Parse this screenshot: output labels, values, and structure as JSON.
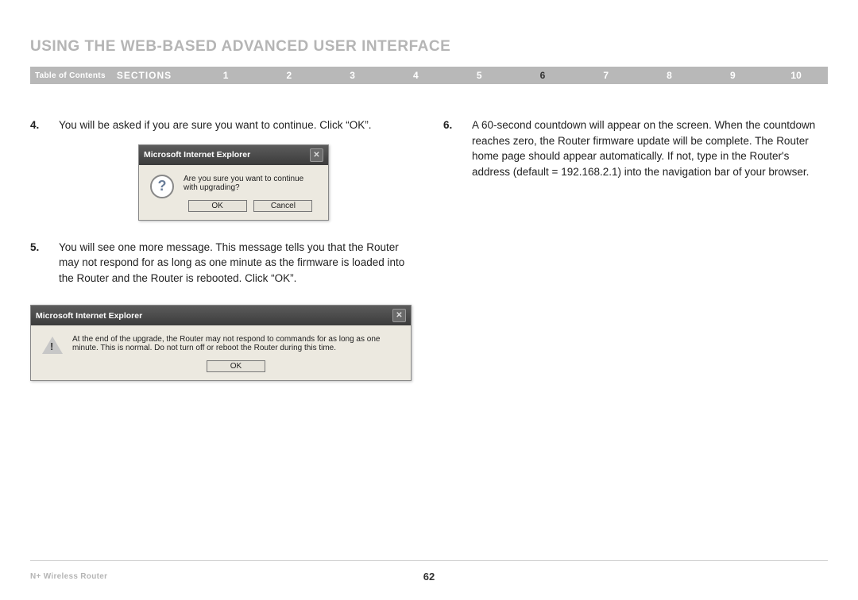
{
  "header": {
    "title": "USING THE WEB-BASED ADVANCED USER INTERFACE"
  },
  "nav": {
    "toc": "Table of Contents",
    "sections_label": "SECTIONS",
    "items": [
      "1",
      "2",
      "3",
      "4",
      "5",
      "6",
      "7",
      "8",
      "9",
      "10"
    ],
    "active_index": 5
  },
  "steps": [
    {
      "num": "4.",
      "text": "You will be asked if you are sure you want to continue. Click “OK”."
    },
    {
      "num": "5.",
      "text": "You will see one more message. This message tells you that the Router may not respond for as long as one minute as the firmware is loaded into the Router and the Router is rebooted. Click “OK”."
    },
    {
      "num": "6.",
      "text": "A 60-second countdown will appear on the screen. When the countdown reaches zero, the Router firmware update will be complete. The Router home page should appear automatically. If not, type in the Router's address (default = 192.168.2.1) into the navigation bar of your browser."
    }
  ],
  "dialog1": {
    "title": "Microsoft Internet Explorer",
    "message": "Are you sure you want to continue with upgrading?",
    "ok": "OK",
    "cancel": "Cancel"
  },
  "dialog2": {
    "title": "Microsoft Internet Explorer",
    "message": "At the end of the upgrade, the Router may not respond to commands for as long as one minute. This is normal. Do not turn off or reboot the Router during this time.",
    "ok": "OK"
  },
  "footer": {
    "product": "N+ Wireless Router",
    "page": "62"
  }
}
